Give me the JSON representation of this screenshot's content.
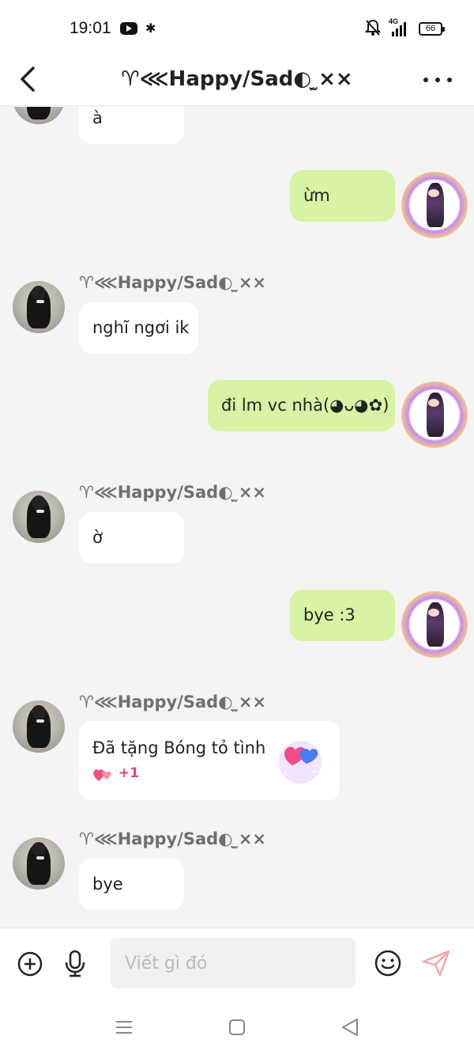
{
  "status_bar": {
    "time": "19:01",
    "battery": "66",
    "network": "4G"
  },
  "header": {
    "title": "♈︎⋘Happy/Sad◐ׅ ×̫×"
  },
  "messages": [
    {
      "text": "à"
    },
    {
      "text": "ừm"
    },
    {
      "sender": "♈︎⋘Happy/Sad◐ׅ ×̫×",
      "text": "nghĩ ngơi ik"
    },
    {
      "text": "đi lm vc nhà(◕ᴗ◕✿)"
    },
    {
      "sender": "♈︎⋘Happy/Sad◐ׅ ×̫×",
      "text": "ờ"
    },
    {
      "text": "bye :3"
    },
    {
      "sender": "♈︎⋘Happy/Sad◐ׅ ×̫×",
      "gift_text": "Đã tặng Bóng tỏ tình",
      "gift_count": "+1"
    },
    {
      "sender": "♈︎⋘Happy/Sad◐ׅ ×̫×",
      "text": "bye"
    }
  ],
  "input": {
    "placeholder": "Viết gì đó"
  },
  "colors": {
    "outgoing_bubble": "#d8f3a4",
    "incoming_bubble": "#ffffff",
    "background": "#f4f4f4",
    "gift_count": "#e0457b"
  },
  "icons": [
    "back-icon",
    "more-icon",
    "add-icon",
    "mic-icon",
    "emoji-icon",
    "send-icon",
    "menu-icon",
    "home-icon",
    "back-nav-icon"
  ]
}
